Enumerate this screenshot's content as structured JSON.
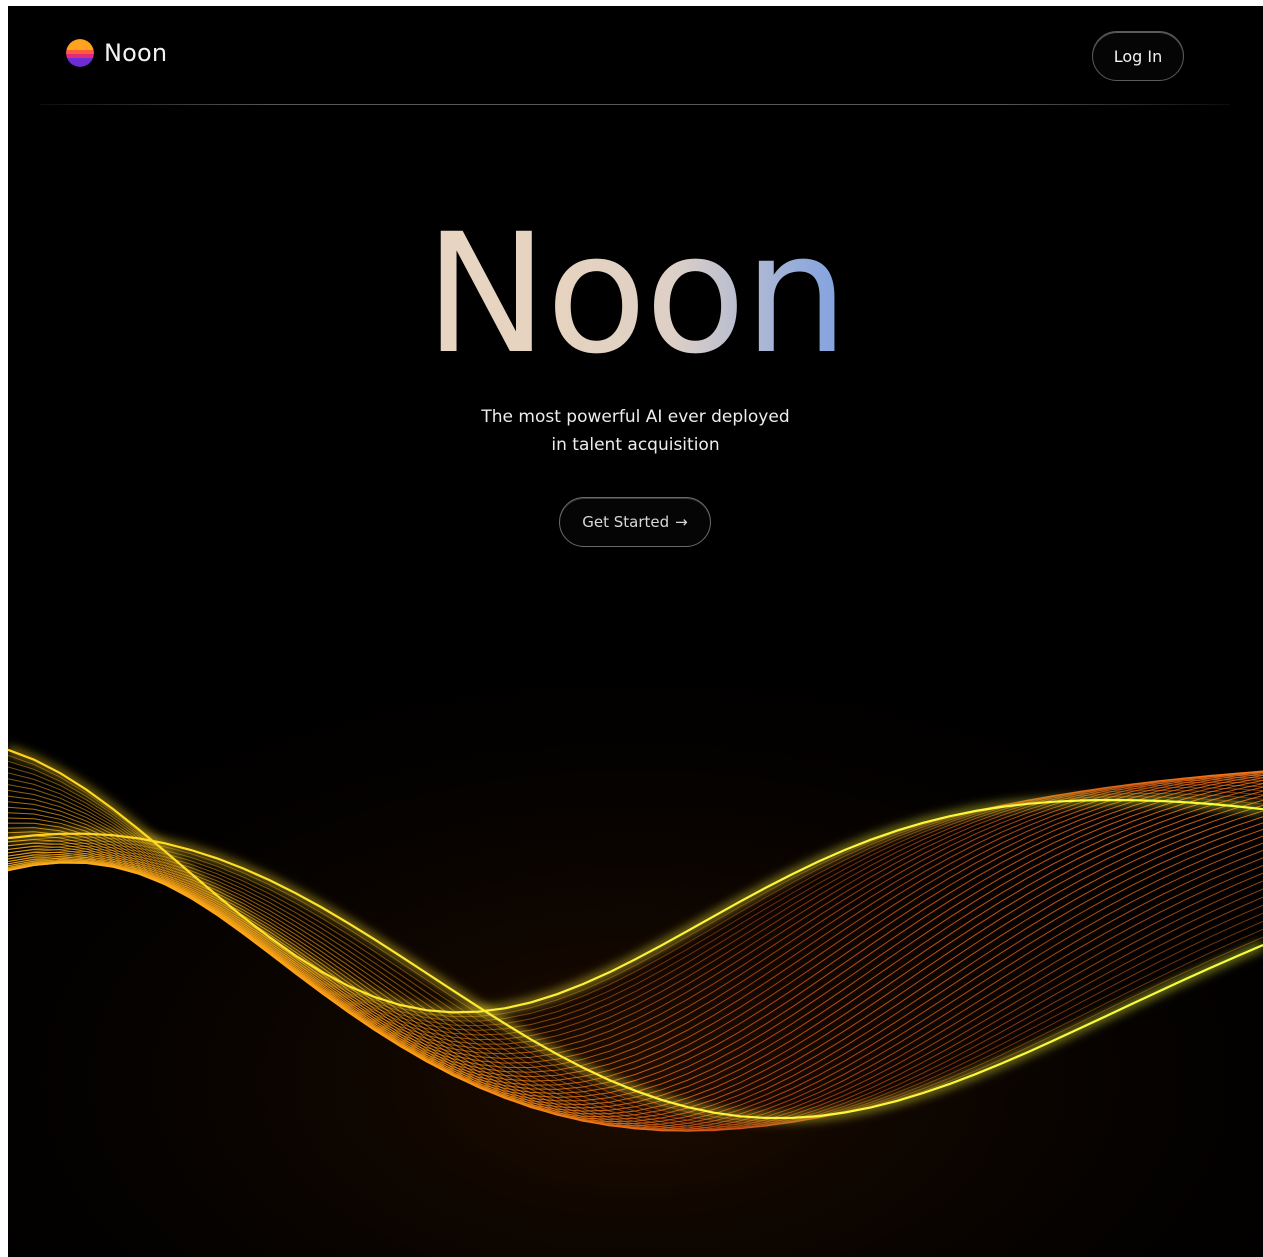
{
  "header": {
    "brand_name": "Noon",
    "login_label": "Log In"
  },
  "hero": {
    "title": "Noon",
    "tagline_line1": "The most powerful AI ever deployed",
    "tagline_line2": "in talent acquisition",
    "cta_label": "Get Started",
    "cta_arrow": "→"
  },
  "colors": {
    "background": "#000000",
    "title_gradient_start": "#ebd8c6",
    "title_gradient_end": "#4f8de8",
    "wave_yellow": "#ffe83a",
    "wave_orange": "#ff8a1a",
    "wave_red": "#d94a10"
  },
  "icons": {
    "logo": "sunset-logo-icon",
    "cta_arrow": "arrow-right-icon"
  }
}
